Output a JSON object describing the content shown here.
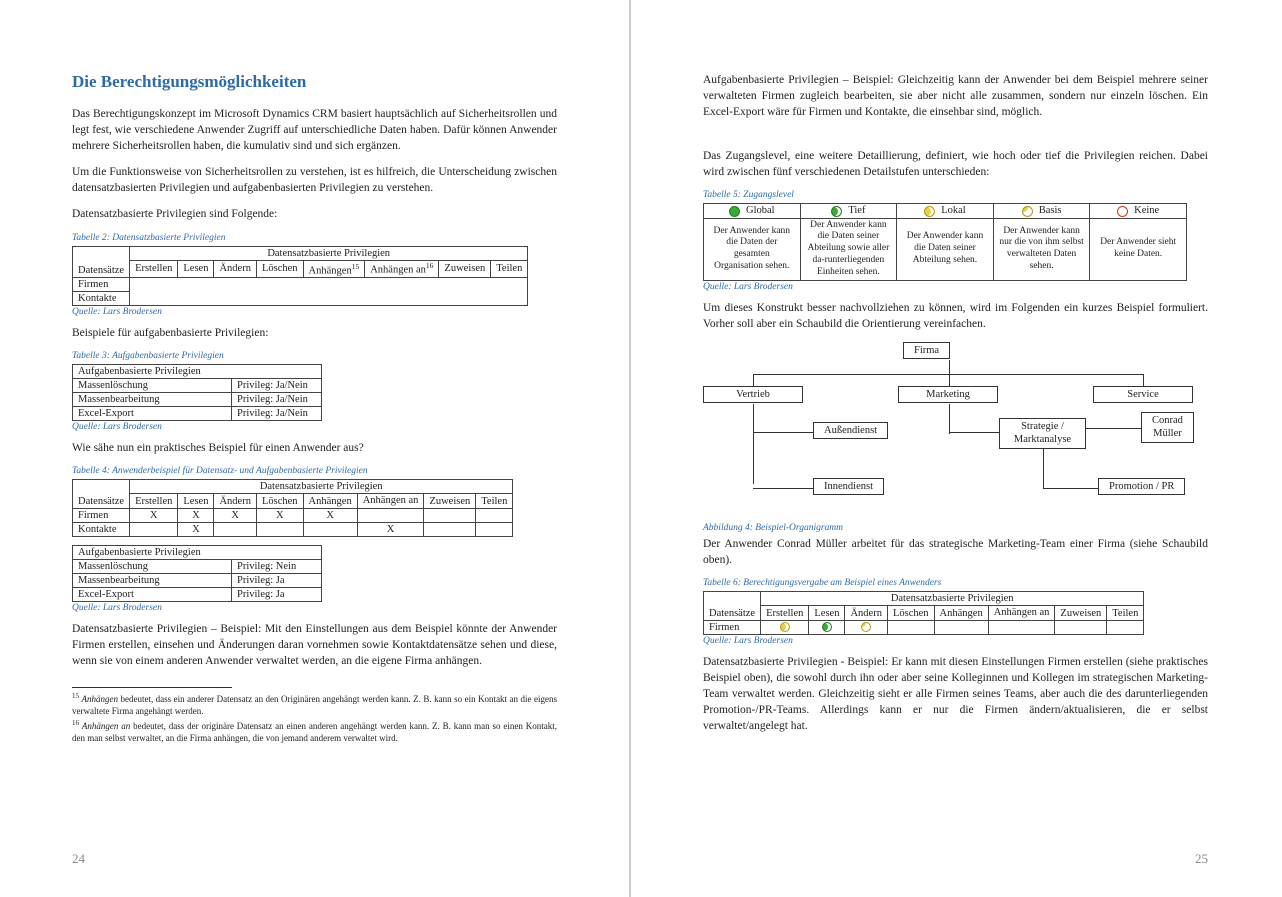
{
  "left": {
    "heading": "Die Berechtigungsmöglichkeiten",
    "para1": "Das Berechtigungskonzept im Microsoft Dynamics CRM basiert hauptsächlich auf Sicherheitsrollen und legt fest, wie verschiedene Anwender Zugriff auf unterschiedliche Daten haben. Dafür können Anwender mehrere Sicherheitsrollen haben, die kumulativ sind und sich ergänzen.",
    "para2": "Um die Funktionsweise von Sicherheitsrollen zu verstehen, ist es hilfreich, die Unterscheidung zwischen datensatzbasierten Privilegien und aufgabenbasierten Privilegien zu verstehen.",
    "para3": "Datensatzbasierte Privilegien sind Folgende:",
    "tab2_caption": "Tabelle 2: Datensatzbasierte Privilegien",
    "tab2": {
      "group_header": "Datensatzbasierte Privilegien",
      "col0": "Datensätze",
      "cols": [
        "Erstellen",
        "Lesen",
        "Ändern",
        "Löschen",
        "Anhängen",
        "Anhängen an",
        "Zuweisen",
        "Teilen"
      ],
      "sup15": "15",
      "sup16": "16",
      "rows": [
        "Firmen",
        "Kontakte"
      ]
    },
    "source": "Quelle: Lars Brodersen",
    "para4": "Beispiele für aufgabenbasierte Privilegien:",
    "tab3_caption": "Tabelle 3: Aufgabenbasierte Privilegien",
    "tab3": {
      "header": "Aufgabenbasierte Privilegien",
      "rows": [
        {
          "label": "Massenlöschung",
          "val": "Privileg: Ja/Nein"
        },
        {
          "label": "Massenbearbeitung",
          "val": "Privileg: Ja/Nein"
        },
        {
          "label": "Excel-Export",
          "val": "Privileg: Ja/Nein"
        }
      ]
    },
    "para5": "Wie sähe nun ein praktisches Beispiel für einen Anwender aus?",
    "tab4_caption": "Tabelle 4: Anwenderbeispiel für Datensatz- und Aufgabenbasierte Privilegien",
    "tab4": {
      "group_header": "Datensatzbasierte Privilegien",
      "col0": "Datensätze",
      "cols": [
        "Erstellen",
        "Lesen",
        "Ändern",
        "Löschen",
        "Anhängen",
        "Anhängen an",
        "Zuweisen",
        "Teilen"
      ],
      "rows": [
        {
          "label": "Firmen",
          "cells": [
            "X",
            "X",
            "X",
            "X",
            "X",
            "",
            "",
            ""
          ]
        },
        {
          "label": "Kontakte",
          "cells": [
            "",
            "X",
            "",
            "",
            "",
            "X",
            "",
            ""
          ]
        }
      ]
    },
    "tab4b": {
      "header": "Aufgabenbasierte Privilegien",
      "rows": [
        {
          "label": "Massenlöschung",
          "val": "Privileg: Nein"
        },
        {
          "label": "Massenbearbeitung",
          "val": "Privileg: Ja"
        },
        {
          "label": "Excel-Export",
          "val": "Privileg: Ja"
        }
      ]
    },
    "para6": "Datensatzbasierte Privilegien – Beispiel: Mit den Einstellungen aus dem Beispiel könnte der Anwender Firmen erstellen, einsehen und Änderungen daran vornehmen sowie Kontaktdatensätze sehen und diese, wenn sie von einem anderen Anwender verwaltet werden, an die eigene Firma anhängen.",
    "fn15_num": "15",
    "fn15_lbl": "Anhängen",
    "fn15": " bedeutet, dass ein anderer Datensatz an den Originären angehängt werden kann. Z. B. kann so ein Kontakt an die eigens verwaltete Firma angehängt werden.",
    "fn16_num": "16",
    "fn16_lbl": "Anhängen an",
    "fn16": " bedeutet, dass der originäre Datensatz an einen anderen angehängt werden kann. Z. B. kann man so einen Kontakt, den man selbst verwaltet, an die Firma anhängen, die von jemand anderem verwaltet wird.",
    "pagenum": "24"
  },
  "right": {
    "para1": "Aufgabenbasierte Privilegien – Beispiel: Gleichzeitig kann der Anwender bei dem Beispiel mehrere seiner verwalteten Firmen zugleich bearbeiten, sie aber nicht alle zusammen, sondern nur einzeln löschen. Ein Excel-Export wäre für Firmen und Kontakte, die einsehbar sind, möglich.",
    "para2": "Das Zugangslevel, eine weitere Detaillierung, definiert, wie hoch oder tief die Privilegien reichen. Dabei wird zwischen fünf verschiedenen Detailstufen unterschieden:",
    "tab5_caption": "Tabelle 5: Zugangslevel",
    "tab5": {
      "headers": [
        "Global",
        "Tief",
        "Lokal",
        "Basis",
        "Keine"
      ],
      "desc": [
        "Der Anwender kann die Daten der gesamten Organisation sehen.",
        "Der Anwender kann die Daten seiner Abteilung sowie aller da-runterliegenden Einheiten sehen.",
        "Der Anwender kann die Daten seiner Abteilung sehen.",
        "Der Anwender kann nur die von ihm selbst verwalteten Daten sehen.",
        "Der Anwender sieht keine Daten."
      ]
    },
    "source": "Quelle: Lars Brodersen",
    "para3": "Um dieses Konstrukt besser nachvollziehen zu können, wird im Folgenden ein kurzes Beispiel formuliert. Vorher soll aber ein Schaubild die Orientierung vereinfachen.",
    "org": {
      "firma": "Firma",
      "vertrieb": "Vertrieb",
      "marketing": "Marketing",
      "service": "Service",
      "aussen": "Außendienst",
      "innen": "Innendienst",
      "strategie": "Strategie /\nMarktanalyse",
      "promo": "Promotion / PR",
      "conrad": "Conrad\nMüller"
    },
    "fig_caption": "Abbildung 4: Beispiel-Organigramm",
    "para4": "Der Anwender Conrad Müller arbeitet für das strategische Marketing-Team einer Firma (siehe Schaubild oben).",
    "tab6_caption": "Tabelle 6: Berechtigungsvergabe am Beispiel eines Anwenders",
    "tab6": {
      "group_header": "Datensatzbasierte Privilegien",
      "col0": "Datensätze",
      "cols": [
        "Erstellen",
        "Lesen",
        "Ändern",
        "Löschen",
        "Anhängen",
        "Anhängen an",
        "Zuweisen",
        "Teilen"
      ],
      "row_label": "Firmen"
    },
    "para5": "Datensatzbasierte Privilegien - Beispiel: Er kann mit diesen Einstellungen Firmen erstellen (siehe praktisches Beispiel oben), die sowohl durch ihn oder aber seine Kolleginnen und Kollegen im strategischen Marketing-Team verwaltet werden. Gleichzeitig sieht er alle Firmen seines Teams, aber auch die des darunterliegenden Promotion-/PR-Teams. Allerdings kann er nur die Firmen ändern/aktualisieren, die er selbst verwaltet/angelegt hat.",
    "pagenum": "25"
  }
}
